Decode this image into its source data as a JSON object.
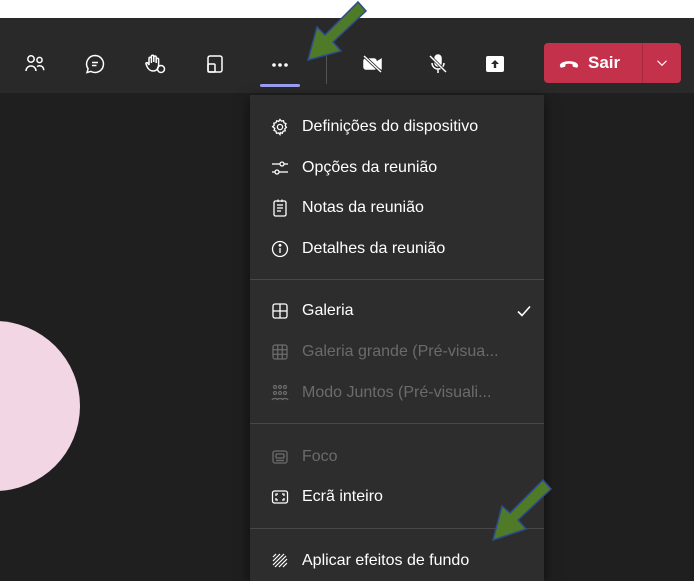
{
  "toolbar": {
    "buttons": [
      {
        "icon": "people-icon"
      },
      {
        "icon": "chat-icon"
      },
      {
        "icon": "raise-hand-icon"
      },
      {
        "icon": "share-tray-icon"
      },
      {
        "icon": "more-icon"
      },
      {
        "icon": "camera-off-icon"
      },
      {
        "icon": "mic-off-icon"
      },
      {
        "icon": "share-content-icon"
      }
    ],
    "leave_label": "Sair",
    "leave_color": "#c4314b",
    "active_underline_color": "#9b9ef0"
  },
  "menu": {
    "groups": [
      [
        {
          "label": "Definições do dispositivo",
          "icon": "gear-icon",
          "enabled": true
        },
        {
          "label": "Opções da reunião",
          "icon": "sliders-icon",
          "enabled": true
        },
        {
          "label": "Notas da reunião",
          "icon": "notes-icon",
          "enabled": true
        },
        {
          "label": "Detalhes da reunião",
          "icon": "info-icon",
          "enabled": true
        }
      ],
      [
        {
          "label": "Galeria",
          "icon": "grid-icon",
          "enabled": true,
          "checked": true
        },
        {
          "label": "Galeria grande (Pré-visua...",
          "icon": "large-grid-icon",
          "enabled": false
        },
        {
          "label": "Modo Juntos (Pré-visuali...",
          "icon": "together-mode-icon",
          "enabled": false
        }
      ],
      [
        {
          "label": "Foco",
          "icon": "focus-icon",
          "enabled": false
        },
        {
          "label": "Ecrã inteiro",
          "icon": "fullscreen-icon",
          "enabled": true
        }
      ],
      [
        {
          "label": "Aplicar efeitos de fundo",
          "icon": "background-effects-icon",
          "enabled": true
        }
      ]
    ]
  },
  "annotations": {
    "arrow_color": "#4f7a28",
    "arrow_outline": "#2e4b8f"
  }
}
